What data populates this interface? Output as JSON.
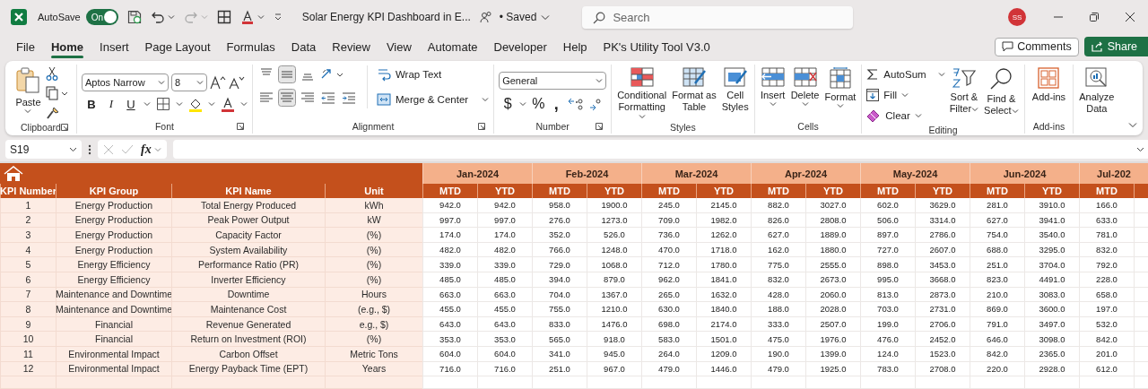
{
  "title_bar": {
    "autosave_label": "AutoSave",
    "autosave_toggle": {
      "label": "On",
      "on": true
    },
    "document_title": "Solar Energy KPI Dashboard in E...",
    "save_status": "• Saved",
    "search": {
      "placeholder": "Search"
    },
    "avatar": "SS"
  },
  "menu_tabs": [
    {
      "label": "File",
      "selected": false
    },
    {
      "label": "Home",
      "selected": true
    },
    {
      "label": "Insert",
      "selected": false
    },
    {
      "label": "Page Layout",
      "selected": false
    },
    {
      "label": "Formulas",
      "selected": false
    },
    {
      "label": "Data",
      "selected": false
    },
    {
      "label": "Review",
      "selected": false
    },
    {
      "label": "View",
      "selected": false
    },
    {
      "label": "Automate",
      "selected": false
    },
    {
      "label": "Developer",
      "selected": false
    },
    {
      "label": "Help",
      "selected": false
    },
    {
      "label": "PK's Utility Tool V3.0",
      "selected": false
    }
  ],
  "comments_button": "Comments",
  "share_button": "Share",
  "ribbon": {
    "clipboard": {
      "paste": "Paste",
      "label": "Clipboard"
    },
    "font": {
      "font_name": "Aptos Narrow",
      "font_size": "8",
      "bold": "B",
      "italic": "I",
      "underline": "U",
      "label": "Font"
    },
    "alignment": {
      "wrap_text": "Wrap Text",
      "merge_center": "Merge & Center",
      "label": "Alignment"
    },
    "number": {
      "format": "General",
      "currency": "$",
      "percent": "%",
      "comma": ",",
      "label": "Number"
    },
    "styles": {
      "conditional_formatting": [
        "Conditional",
        "Formatting"
      ],
      "format_as_table": [
        "Format as",
        "Table"
      ],
      "cell_styles": [
        "Cell",
        "Styles"
      ],
      "label": "Styles"
    },
    "cells": {
      "insert": "Insert",
      "delete": "Delete",
      "format": "Format",
      "label": "Cells"
    },
    "editing": {
      "autosum": "AutoSum",
      "fill": "Fill",
      "clear": "Clear",
      "sort_filter": [
        "Sort &",
        "Filter"
      ],
      "find_select": [
        "Find &",
        "Select"
      ],
      "label": "Editing"
    },
    "addins": {
      "addins": "Add-ins",
      "label": "Add-ins"
    },
    "analyze_data": [
      "Analyze",
      "Data"
    ]
  },
  "formula_bar": {
    "name_box": "S19",
    "function_button": "fx"
  },
  "sheet": {
    "columns": [
      "KPI Number",
      "KPI Group",
      "KPI Name",
      "Unit"
    ],
    "months": [
      {
        "label": "Jan-2024",
        "columns": [
          "MTD",
          "YTD"
        ]
      },
      {
        "label": "Feb-2024",
        "columns": [
          "MTD",
          "YTD"
        ]
      },
      {
        "label": "Mar-2024",
        "columns": [
          "MTD",
          "YTD"
        ]
      },
      {
        "label": "Apr-2024",
        "columns": [
          "MTD",
          "YTD"
        ]
      },
      {
        "label": "May-2024",
        "columns": [
          "MTD",
          "YTD"
        ]
      },
      {
        "label": "Jun-2024",
        "columns": [
          "MTD",
          "YTD"
        ]
      },
      {
        "label": "Jul-202",
        "columns": [
          "MTD"
        ]
      }
    ],
    "rows": [
      {
        "number": "1",
        "group": "Energy Production",
        "name": "Total Energy Produced",
        "unit": "kWh",
        "values": [
          "942.0",
          "942.0",
          "958.0",
          "1900.0",
          "245.0",
          "2145.0",
          "882.0",
          "3027.0",
          "602.0",
          "3629.0",
          "281.0",
          "3910.0",
          "166.0"
        ]
      },
      {
        "number": "2",
        "group": "Energy Production",
        "name": "Peak Power Output",
        "unit": "kW",
        "values": [
          "997.0",
          "997.0",
          "276.0",
          "1273.0",
          "709.0",
          "1982.0",
          "826.0",
          "2808.0",
          "506.0",
          "3314.0",
          "627.0",
          "3941.0",
          "633.0"
        ]
      },
      {
        "number": "3",
        "group": "Energy Production",
        "name": "Capacity Factor",
        "unit": "(%)",
        "values": [
          "174.0",
          "174.0",
          "352.0",
          "526.0",
          "736.0",
          "1262.0",
          "627.0",
          "1889.0",
          "897.0",
          "2786.0",
          "754.0",
          "3540.0",
          "781.0"
        ]
      },
      {
        "number": "4",
        "group": "Energy Production",
        "name": "System Availability",
        "unit": "(%)",
        "values": [
          "482.0",
          "482.0",
          "766.0",
          "1248.0",
          "470.0",
          "1718.0",
          "162.0",
          "1880.0",
          "727.0",
          "2607.0",
          "688.0",
          "3295.0",
          "832.0"
        ]
      },
      {
        "number": "5",
        "group": "Energy Efficiency",
        "name": "Performance Ratio (PR)",
        "unit": "(%)",
        "values": [
          "339.0",
          "339.0",
          "729.0",
          "1068.0",
          "712.0",
          "1780.0",
          "775.0",
          "2555.0",
          "898.0",
          "3453.0",
          "251.0",
          "3704.0",
          "792.0"
        ]
      },
      {
        "number": "6",
        "group": "Energy Efficiency",
        "name": "Inverter Efficiency",
        "unit": "(%)",
        "values": [
          "485.0",
          "485.0",
          "394.0",
          "879.0",
          "962.0",
          "1841.0",
          "832.0",
          "2673.0",
          "995.0",
          "3668.0",
          "823.0",
          "4491.0",
          "228.0"
        ]
      },
      {
        "number": "7",
        "group": "Maintenance and Downtime",
        "name": "Downtime",
        "unit": "Hours",
        "values": [
          "663.0",
          "663.0",
          "704.0",
          "1367.0",
          "265.0",
          "1632.0",
          "428.0",
          "2060.0",
          "813.0",
          "2873.0",
          "210.0",
          "3083.0",
          "658.0"
        ]
      },
      {
        "number": "8",
        "group": "Maintenance and Downtime",
        "name": "Maintenance Cost",
        "unit": "(e.g., $)",
        "values": [
          "455.0",
          "455.0",
          "755.0",
          "1210.0",
          "630.0",
          "1840.0",
          "188.0",
          "2028.0",
          "703.0",
          "2731.0",
          "869.0",
          "3600.0",
          "197.0"
        ]
      },
      {
        "number": "9",
        "group": "Financial",
        "name": "Revenue Generated",
        "unit": "e.g., $)",
        "values": [
          "643.0",
          "643.0",
          "833.0",
          "1476.0",
          "698.0",
          "2174.0",
          "333.0",
          "2507.0",
          "199.0",
          "2706.0",
          "791.0",
          "3497.0",
          "532.0"
        ]
      },
      {
        "number": "10",
        "group": "Financial",
        "name": "Return on Investment (ROI)",
        "unit": "(%)",
        "values": [
          "353.0",
          "353.0",
          "565.0",
          "918.0",
          "583.0",
          "1501.0",
          "475.0",
          "1976.0",
          "476.0",
          "2452.0",
          "646.0",
          "3098.0",
          "842.0"
        ]
      },
      {
        "number": "11",
        "group": "Environmental Impact",
        "name": "Carbon Offset",
        "unit": "Metric Tons",
        "values": [
          "604.0",
          "604.0",
          "341.0",
          "945.0",
          "264.0",
          "1209.0",
          "190.0",
          "1399.0",
          "124.0",
          "1523.0",
          "842.0",
          "2365.0",
          "201.0"
        ]
      },
      {
        "number": "12",
        "group": "Environmental Impact",
        "name": "Energy Payback Time (EPT)",
        "unit": "Years",
        "values": [
          "716.0",
          "716.0",
          "251.0",
          "967.0",
          "479.0",
          "1446.0",
          "479.0",
          "1925.0",
          "783.0",
          "2708.0",
          "220.0",
          "2928.0",
          "612.0"
        ]
      }
    ]
  }
}
